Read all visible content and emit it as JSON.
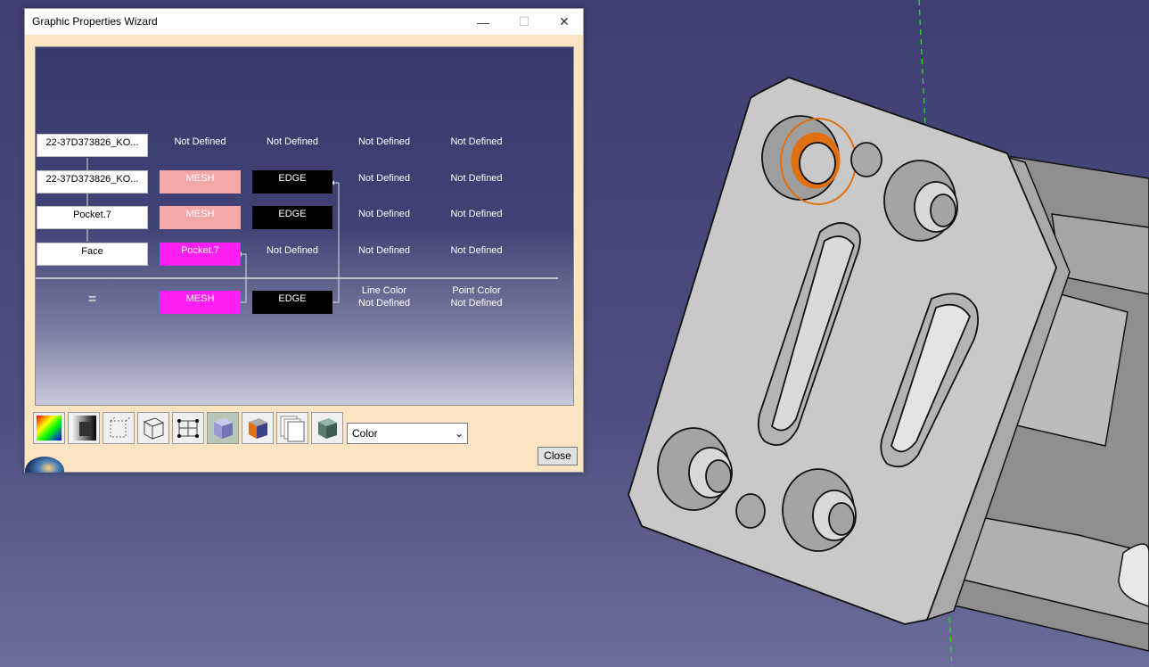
{
  "window": {
    "title": "Graphic Properties Wizard",
    "minimize_glyph": "—",
    "maximize_glyph": "☐",
    "close_glyph": "✕"
  },
  "graph": {
    "rows": [
      {
        "c0": "22-37D373826_KO...",
        "c1": "Not Defined",
        "c2": "Not Defined",
        "c3": "Not Defined",
        "c4": "Not Defined"
      },
      {
        "c0": "22-37D373826_KO...",
        "c1": "MESH",
        "c2": "EDGE",
        "c3": "Not Defined",
        "c4": "Not Defined"
      },
      {
        "c0": "Pocket.7",
        "c1": "MESH",
        "c2": "EDGE",
        "c3": "Not Defined",
        "c4": "Not Defined"
      },
      {
        "c0": "Face",
        "c1": "Pocket.7",
        "c2": "Not Defined",
        "c3": "Not Defined",
        "c4": "Not Defined"
      }
    ],
    "result": {
      "equals": "=",
      "c1": "MESH",
      "c2": "EDGE",
      "c3_line1": "Line Color",
      "c3_line2": "Not Defined",
      "c4_line1": "Point Color",
      "c4_line2": "Not Defined"
    }
  },
  "toolbar": {
    "icons": [
      "color-wheel-icon",
      "gradient-cube-icon",
      "dotted-box-icon",
      "wireframe-cube-icon",
      "points-box-icon",
      "shaded-cube-icon",
      "orange-cube-icon",
      "layers-icon",
      "dark-cube-icon"
    ],
    "active_index": 5
  },
  "filter": {
    "selected": "Color"
  },
  "buttons": {
    "close": "Close"
  },
  "colors": {
    "mesh_pink": "#f5a8a8",
    "magenta": "#ff1ff4",
    "highlight_orange": "#e07010",
    "part_gray": "#c8c8c8",
    "background": "#3d3f72"
  }
}
